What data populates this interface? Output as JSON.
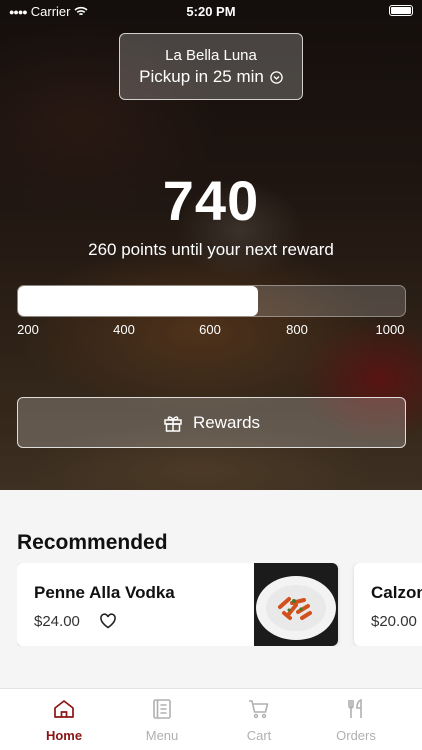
{
  "status_bar": {
    "carrier": "Carrier",
    "time": "5:20 PM"
  },
  "location": {
    "name": "La Bella Luna",
    "pickup": "Pickup in 25 min"
  },
  "points": {
    "value": "740",
    "subtitle": "260 points until your next reward",
    "progress_fraction": 0.62
  },
  "progress_ticks": [
    "200",
    "400",
    "600",
    "800",
    "1000"
  ],
  "rewards_button": {
    "label": "Rewards"
  },
  "recommended": {
    "title": "Recommended",
    "items": [
      {
        "name": "Penne Alla Vodka",
        "price": "$24.00"
      },
      {
        "name": "Calzone",
        "price": "$20.00"
      }
    ]
  },
  "tabs": [
    {
      "label": "Home",
      "icon": "home-icon",
      "active": true
    },
    {
      "label": "Menu",
      "icon": "menu-icon",
      "active": false
    },
    {
      "label": "Cart",
      "icon": "cart-icon",
      "active": false
    },
    {
      "label": "Orders",
      "icon": "orders-icon",
      "active": false
    }
  ],
  "colors": {
    "accent": "#8b1414",
    "inactive_tab": "#b0b0b0"
  }
}
